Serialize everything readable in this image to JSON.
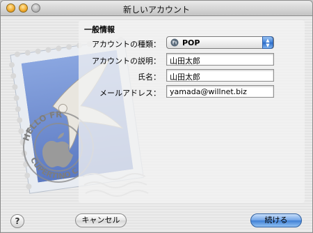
{
  "window": {
    "title": "新しいアカウント"
  },
  "section": {
    "title": "一般情報"
  },
  "form": {
    "account_type": {
      "label": "アカウントの種類：",
      "value": "POP",
      "icon": "globe-icon"
    },
    "account_description": {
      "label": "アカウントの説明：",
      "value": "山田太郎"
    },
    "full_name": {
      "label": "氏名：",
      "value": "山田太郎"
    },
    "email": {
      "label": "メールアドレス：",
      "value": "yamada@willnet.biz"
    }
  },
  "footer": {
    "help_label": "?",
    "cancel_label": "キャンセル",
    "continue_label": "続ける"
  },
  "stamp": {
    "postmark_text_top": "HELLO FR",
    "postmark_text_bottom": "CUPERTINO C"
  }
}
